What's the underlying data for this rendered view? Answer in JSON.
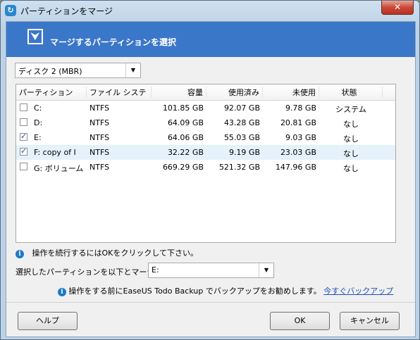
{
  "window": {
    "title": "パーティションをマージ",
    "close_glyph": "✕"
  },
  "banner": {
    "text": "マージするパーティションを選択",
    "icon": "merge-icon"
  },
  "disk_select": {
    "value": "ディスク 2 (MBR)"
  },
  "table": {
    "headers": [
      "パーティション",
      "ファイル システ",
      "容量",
      "使用済み",
      "未使用",
      "状態"
    ],
    "rows": [
      {
        "partition": "C:",
        "fs": "NTFS",
        "capacity": "101.85 GB",
        "used": "92.07 GB",
        "unused": "9.78 GB",
        "status": "システム",
        "checked": false,
        "selected": false
      },
      {
        "partition": "D:",
        "fs": "NTFS",
        "capacity": "64.09 GB",
        "used": "43.28 GB",
        "unused": "20.81 GB",
        "status": "なし",
        "checked": false,
        "selected": false
      },
      {
        "partition": "E:",
        "fs": "NTFS",
        "capacity": "64.06 GB",
        "used": "55.03 GB",
        "unused": "9.03 GB",
        "status": "なし",
        "checked": true,
        "selected": false
      },
      {
        "partition": "F: copy of I",
        "fs": "NTFS",
        "capacity": "32.22 GB",
        "used": "9.19 GB",
        "unused": "23.03 GB",
        "status": "なし",
        "checked": true,
        "selected": true
      },
      {
        "partition": "G: ボリューム",
        "fs": "NTFS",
        "capacity": "669.29 GB",
        "used": "521.32 GB",
        "unused": "147.96 GB",
        "status": "なし",
        "checked": false,
        "selected": false
      }
    ]
  },
  "hint": {
    "text": "操作を続行するにはOKをクリックして下さい。"
  },
  "merge_target": {
    "label": "選択したパーティションを以下とマージ：",
    "value": "E:"
  },
  "backup_notice": {
    "text": "操作をする前にEaseUS Todo Backup でバックアップをお勧めします。",
    "link": "今すぐバックアップ"
  },
  "buttons": {
    "help": "ヘルプ",
    "ok": "OK",
    "cancel": "キャンセル"
  },
  "colors": {
    "banner": "#3b77c9",
    "selected_row": "#e5f1fb",
    "link": "#1a4fb8"
  }
}
